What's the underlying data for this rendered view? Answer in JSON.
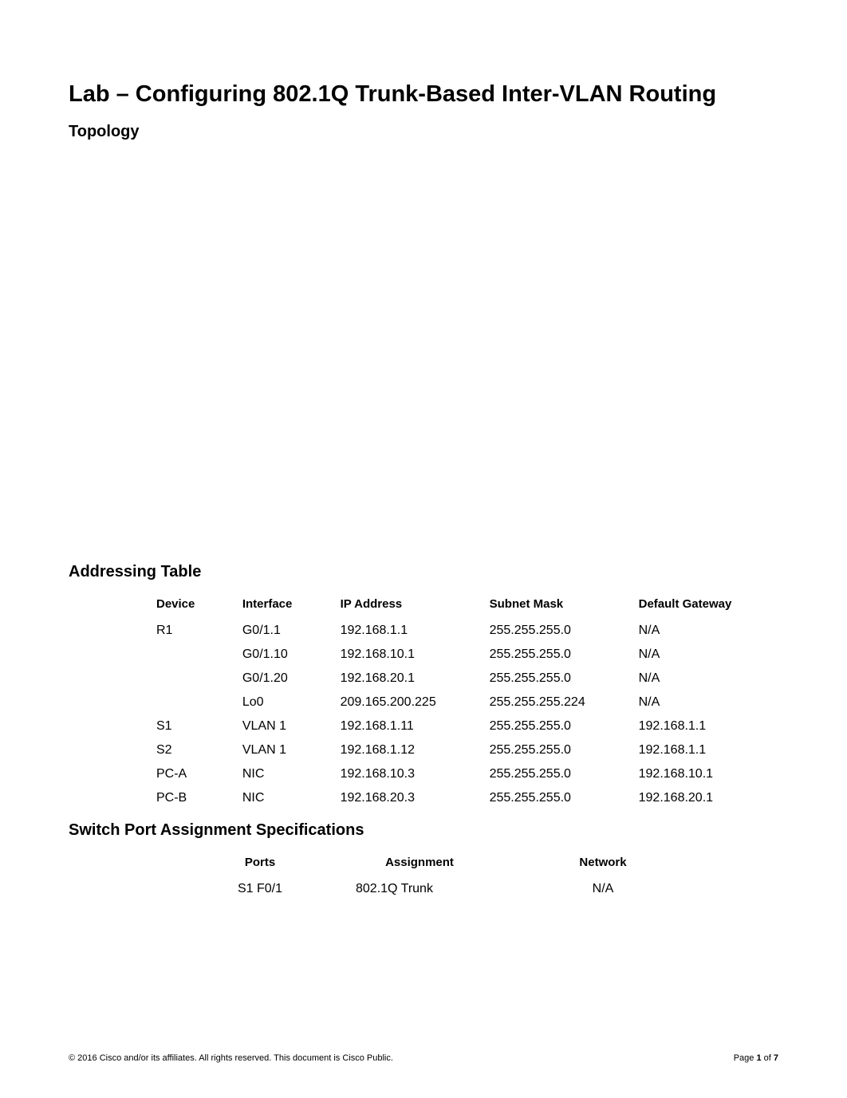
{
  "title": "Lab – Configuring 802.1Q Trunk-Based Inter-VLAN Routing",
  "sections": {
    "topology": "Topology",
    "addressing": "Addressing Table",
    "specs": "Switch Port Assignment Specifications"
  },
  "addressing_headers": {
    "device": "Device",
    "interface": "Interface",
    "ip": "IP Address",
    "mask": "Subnet Mask",
    "gw": "Default Gateway"
  },
  "addressing_rows": [
    {
      "device": "R1",
      "interface": "G0/1.1",
      "ip": "192.168.1.1",
      "mask": "255.255.255.0",
      "gw": "N/A"
    },
    {
      "device": "",
      "interface": "G0/1.10",
      "ip": "192.168.10.1",
      "mask": "255.255.255.0",
      "gw": "N/A"
    },
    {
      "device": "",
      "interface": "G0/1.20",
      "ip": "192.168.20.1",
      "mask": "255.255.255.0",
      "gw": "N/A"
    },
    {
      "device": "",
      "interface": "Lo0",
      "ip": "209.165.200.225",
      "mask": "255.255.255.224",
      "gw": "N/A"
    },
    {
      "device": "S1",
      "interface": "VLAN 1",
      "ip": "192.168.1.11",
      "mask": "255.255.255.0",
      "gw": "192.168.1.1"
    },
    {
      "device": "S2",
      "interface": "VLAN 1",
      "ip": "192.168.1.12",
      "mask": "255.255.255.0",
      "gw": "192.168.1.1"
    },
    {
      "device": "PC-A",
      "interface": "NIC",
      "ip": "192.168.10.3",
      "mask": "255.255.255.0",
      "gw": "192.168.10.1"
    },
    {
      "device": "PC-B",
      "interface": "NIC",
      "ip": "192.168.20.3",
      "mask": "255.255.255.0",
      "gw": "192.168.20.1"
    }
  ],
  "spec_headers": {
    "ports": "Ports",
    "assignment": "Assignment",
    "network": "Network"
  },
  "spec_rows": [
    {
      "ports": "S1 F0/1",
      "assignment": "802.1Q Trunk",
      "network": "N/A"
    }
  ],
  "footer": {
    "copyright": "© 2016 Cisco and/or its affiliates. All rights reserved. This document is Cisco Public.",
    "page_prefix": "Page ",
    "page_current": "1",
    "page_of": " of ",
    "page_total": "7"
  }
}
